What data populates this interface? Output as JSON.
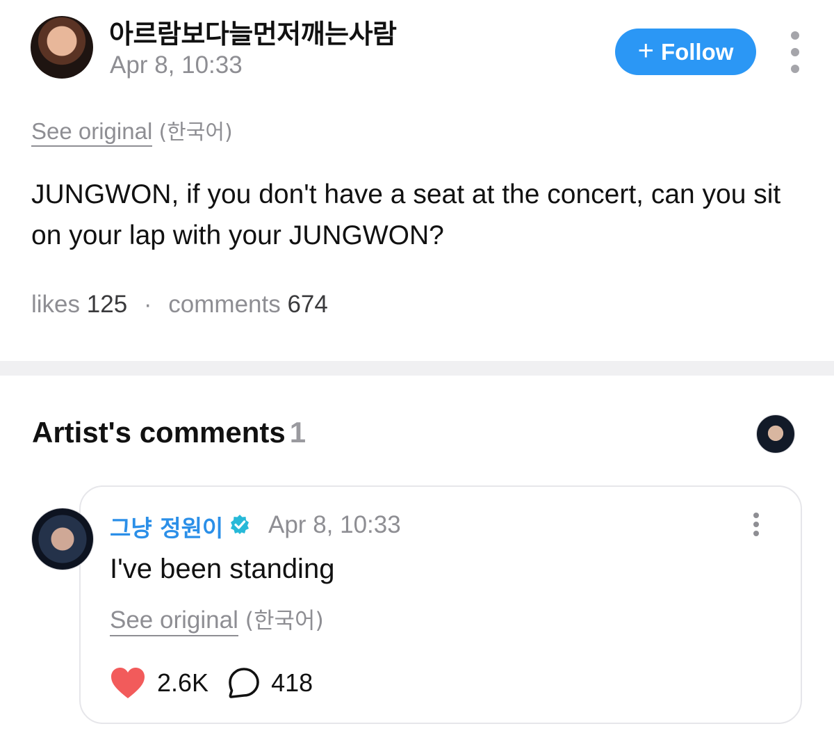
{
  "post": {
    "author": "아르람보다늘먼저깨는사람",
    "time": "Apr 8, 10:33",
    "follow_label": "Follow",
    "see_original": "See original",
    "language": "(한국어)",
    "body": "JUNGWON, if you don't have a seat at the concert, can you sit on your lap with your JUNGWON?",
    "likes_label": "likes",
    "likes_count": "125",
    "separator": "·",
    "comments_label": "comments",
    "comments_count": "674"
  },
  "artist_comments": {
    "title": "Artist's comments",
    "count": "1"
  },
  "comment": {
    "author": "그냥 정원이",
    "time": "Apr 8, 10:33",
    "text": "I've been standing",
    "see_original": "See original",
    "language": "(한국어)",
    "likes": "2.6K",
    "replies": "418"
  },
  "icons": {
    "follow": "plus-icon",
    "more": "more-vertical-icon",
    "verified": "verified-badge-icon",
    "like": "heart-icon",
    "reply": "comment-bubble-icon"
  },
  "colors": {
    "accent": "#2b97f5",
    "verified": "#27b9d8",
    "heart": "#f25b5b",
    "muted_text": "#8e8e93"
  }
}
